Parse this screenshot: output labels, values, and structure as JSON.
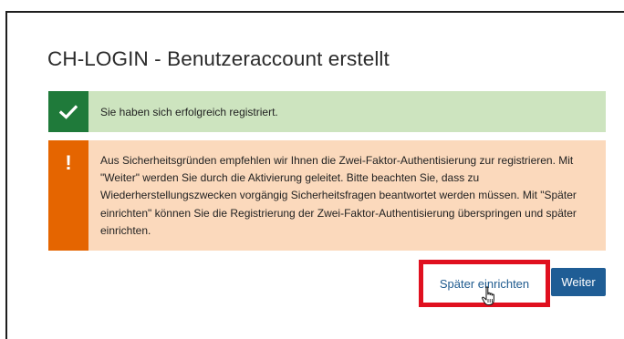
{
  "page": {
    "title": "CH-LOGIN - Benutzeraccount erstellt"
  },
  "success_alert": {
    "icon": "check-icon",
    "message": "Sie haben sich erfolgreich registriert.",
    "stripe_color": "#1f7a3a",
    "background_color": "#cde4bf"
  },
  "warning_alert": {
    "icon": "exclamation-icon",
    "message": "Aus Sicherheitsgründen empfehlen wir Ihnen die Zwei-Faktor-Authentisierung zur registrieren. Mit \"Weiter\" werden Sie durch die Aktivierung geleitet. Bitte beachten Sie, dass zu Wiederherstellungszwecken vorgängig Sicherheitsfragen beantwortet werden müssen. Mit \"Später einrichten\" können Sie die Registrierung der Zwei-Faktor-Authentisierung überspringen und später einrichten.",
    "stripe_color": "#e56500",
    "background_color": "#fbd9bc"
  },
  "actions": {
    "later_label": "Später einrichten",
    "next_label": "Weiter",
    "next_color": "#1f5d95",
    "highlight_color": "#e0101f"
  },
  "cursor": {
    "icon": "hand-pointer-icon"
  }
}
